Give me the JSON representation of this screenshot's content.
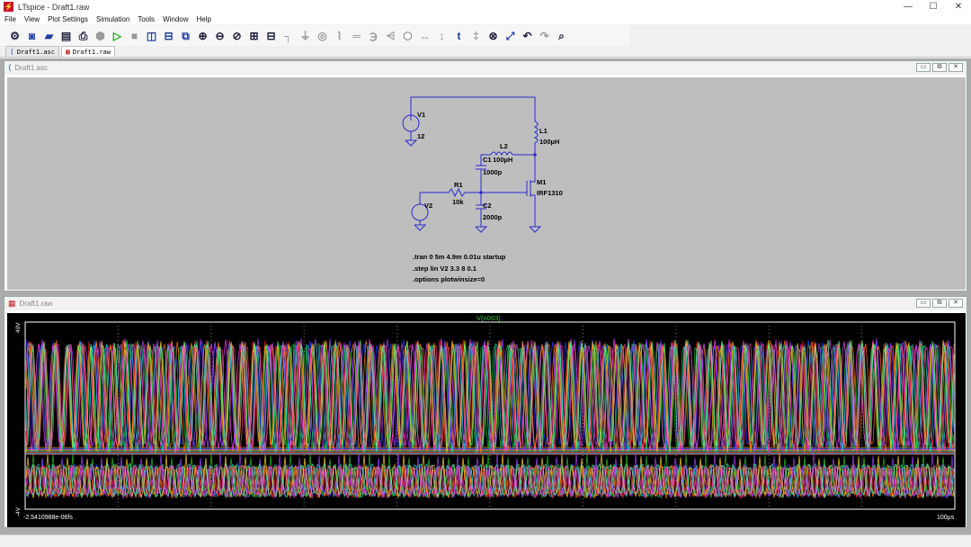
{
  "app": {
    "title": "LTspice - Draft1.raw",
    "window_controls": [
      "—",
      "☐",
      "✕"
    ]
  },
  "menu": [
    "File",
    "View",
    "Plot Settings",
    "Simulation",
    "Tools",
    "Window",
    "Help"
  ],
  "toolbar_icons": [
    {
      "name": "gear-icon",
      "glyph": "⚙",
      "tone": "dark"
    },
    {
      "name": "new-schematic-icon",
      "glyph": "◙",
      "tone": "blue"
    },
    {
      "name": "open-folder-icon",
      "glyph": "▰",
      "tone": "blue"
    },
    {
      "name": "save-icon",
      "glyph": "▤",
      "tone": "dark"
    },
    {
      "name": "print-icon",
      "glyph": "⎙",
      "tone": "dark"
    },
    {
      "name": "halt-icon",
      "glyph": "⬢",
      "tone": "grey"
    },
    {
      "name": "run-icon",
      "glyph": "▷",
      "tone": "green"
    },
    {
      "name": "stop-icon",
      "glyph": "■",
      "tone": "grey"
    },
    {
      "name": "tile-vertical-icon",
      "glyph": "◫",
      "tone": "blue"
    },
    {
      "name": "tile-horizontal-icon",
      "glyph": "⊟",
      "tone": "blue"
    },
    {
      "name": "cascade-icon",
      "glyph": "⧉",
      "tone": "blue"
    },
    {
      "name": "zoom-in-icon",
      "glyph": "⊕",
      "tone": "dark"
    },
    {
      "name": "zoom-out-icon",
      "glyph": "⊖",
      "tone": "dark"
    },
    {
      "name": "zoom-fit-icon",
      "glyph": "⊘",
      "tone": "dark"
    },
    {
      "name": "autorange-icon",
      "glyph": "⊞",
      "tone": "dark"
    },
    {
      "name": "fft-icon",
      "glyph": "⊟",
      "tone": "dark"
    },
    {
      "name": "wire-icon",
      "glyph": "┐",
      "tone": "grey"
    },
    {
      "name": "ground-icon",
      "glyph": "⏚",
      "tone": "grey"
    },
    {
      "name": "label-net-icon",
      "glyph": "◎",
      "tone": "grey"
    },
    {
      "name": "resistor-icon",
      "glyph": "⌇",
      "tone": "grey"
    },
    {
      "name": "capacitor-icon",
      "glyph": "═",
      "tone": "grey"
    },
    {
      "name": "inductor-icon",
      "glyph": "℈",
      "tone": "grey"
    },
    {
      "name": "diode-icon",
      "glyph": "⩤",
      "tone": "grey"
    },
    {
      "name": "component-icon",
      "glyph": "⬡",
      "tone": "grey"
    },
    {
      "name": "move-icon",
      "glyph": "↔",
      "tone": "grey"
    },
    {
      "name": "drag-icon",
      "glyph": "↕",
      "tone": "grey"
    },
    {
      "name": "text-icon",
      "glyph": "t",
      "tone": "blue"
    },
    {
      "name": "spice-directive-icon",
      "glyph": "‡",
      "tone": "grey"
    },
    {
      "name": "delete-icon",
      "glyph": "⊗",
      "tone": "dark"
    },
    {
      "name": "duplicate-icon",
      "glyph": "⤢",
      "tone": "blue"
    },
    {
      "name": "undo-icon",
      "glyph": "↶",
      "tone": "dark"
    },
    {
      "name": "redo-icon",
      "glyph": "↷",
      "tone": "grey"
    },
    {
      "name": "find-icon",
      "glyph": "⌕",
      "tone": "dark"
    }
  ],
  "tabs": [
    {
      "label": "Draft1.asc",
      "active": false
    },
    {
      "label": "Draft1.raw",
      "active": true
    }
  ],
  "schematic": {
    "title": "Draft1.asc",
    "labels": {
      "v1": "V1",
      "v1_val": "12",
      "l1": "L1",
      "l1_val": "100µH",
      "l2": "L2",
      "l2_val": "100µH",
      "c1": "C1",
      "c1_val": "1000p",
      "r1": "R1",
      "r1_val": "10k",
      "c2": "C2",
      "c2_val": "2000p",
      "m1": "M1",
      "m1_val": "IRF1310",
      "v2": "V2"
    },
    "directives": [
      ".tran 0 5m 4.9m 0.01u startup",
      ".step lin V2 3.3 8 0.1",
      ".options plotwinsize=0"
    ]
  },
  "plot": {
    "title": "Draft1.raw",
    "trace_label": "V(n003)",
    "y_top": "40V",
    "y_bottom": "-4V",
    "x_left": "-2.5410988e-06fs",
    "x_right": "100µs",
    "colors": {
      "trace_label": "#38d038",
      "axis": "#ffffff",
      "grid": "#7a7a7a"
    },
    "trace_colors": [
      "#ff2020",
      "#20c020",
      "#2040ff",
      "#ff40ff",
      "#ffd020",
      "#20e0e0",
      "#ff8000",
      "#a040ff",
      "#40ff80",
      "#ff4090"
    ]
  }
}
